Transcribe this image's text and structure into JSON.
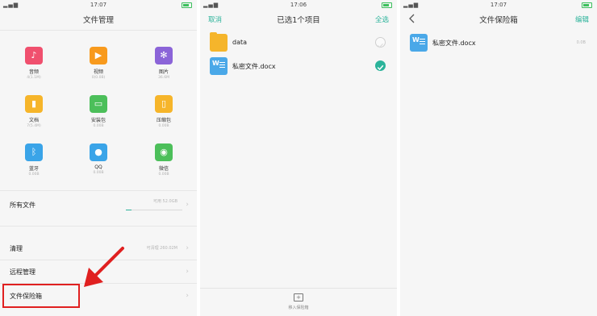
{
  "status": {
    "time1": "17:07",
    "time2": "17:06",
    "time3": "17:07",
    "signal": "all wifi"
  },
  "colors": {
    "accent": "#2bb39a",
    "highlight": "#e02020"
  },
  "panel1": {
    "title": "文件管理",
    "categories": [
      {
        "label": "音频",
        "sub": "4(1.1M)",
        "color": "#f0506e",
        "icon": "music-icon"
      },
      {
        "label": "视频",
        "sub": "0(0.0B)",
        "color": "#f89a1d",
        "icon": "play-icon"
      },
      {
        "label": "图片",
        "sub": "36.6M",
        "color": "#8b64d8",
        "icon": "flower-icon"
      },
      {
        "label": "文档",
        "sub": "7(5.4M)",
        "color": "#f6b52a",
        "icon": "bars-icon"
      },
      {
        "label": "安装包",
        "sub": "0.00B",
        "color": "#4cbf5a",
        "icon": "android-icon"
      },
      {
        "label": "压缩包",
        "sub": "0.00B",
        "color": "#f6b52a",
        "icon": "zip-icon"
      },
      {
        "label": "蓝牙",
        "sub": "0.00B",
        "color": "#3aa4e8",
        "icon": "bluetooth-icon"
      },
      {
        "label": "QQ",
        "sub": "0.00B",
        "color": "#3aa4e8",
        "icon": "qq-icon"
      },
      {
        "label": "微信",
        "sub": "0.00B",
        "color": "#4cbf5a",
        "icon": "wechat-icon"
      }
    ],
    "all_files": {
      "label": "所有文件",
      "value": "可用 52.0GB",
      "usage_fraction": 0.1
    },
    "rows": [
      {
        "label": "清理",
        "value": "可清理 260.02M"
      },
      {
        "label": "远程管理",
        "value": ""
      },
      {
        "label": "文件保险箱",
        "value": ""
      }
    ]
  },
  "panel2": {
    "cancel": "取消",
    "title": "已选1个项目",
    "select_all": "全选",
    "files": [
      {
        "name": "data",
        "type": "folder",
        "checked": false
      },
      {
        "name": "私密文件.docx",
        "type": "doc",
        "checked": true
      }
    ],
    "bottom_action": "移入保险箱"
  },
  "panel3": {
    "title": "文件保险箱",
    "edit": "编辑",
    "files": [
      {
        "name": "私密文件.docx",
        "size": "0.0B"
      }
    ]
  }
}
